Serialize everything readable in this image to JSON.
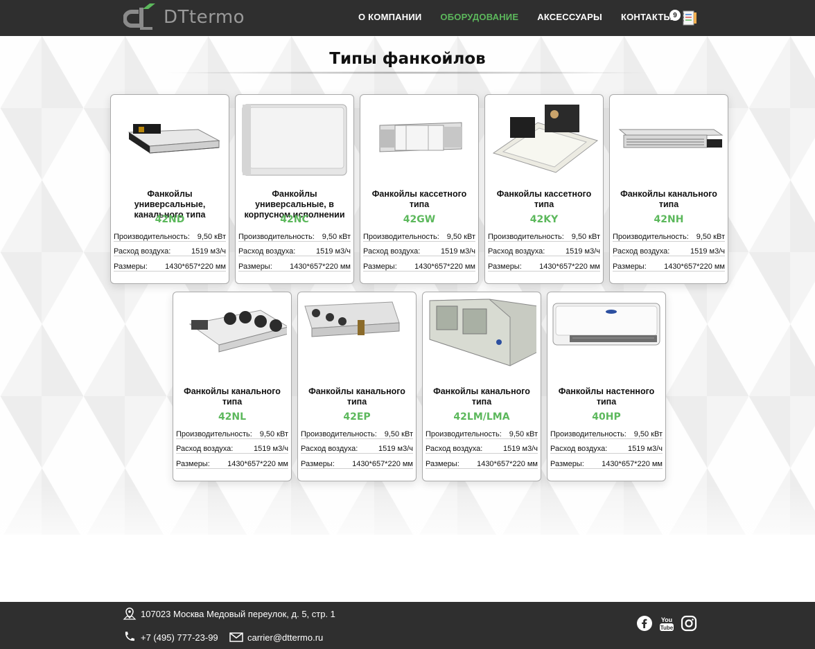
{
  "header": {
    "logo_text": "DTtermo",
    "nav": [
      {
        "label": "О КОМПАНИИ",
        "active": false
      },
      {
        "label": "ОБОРУДОВАНИЕ",
        "active": true
      },
      {
        "label": "АКСЕССУАРЫ",
        "active": false
      },
      {
        "label": "КОНТАКТЫ",
        "active": false
      }
    ],
    "cart_count": "9",
    "cart_icon": "notepad-cart-icon"
  },
  "page": {
    "title": "Типы фанкойлов"
  },
  "spec_labels": {
    "capacity": "Производительность:",
    "airflow": "Расход воздуха:",
    "size": "Размеры:"
  },
  "cards": [
    {
      "title": "Фанкойлы универсальные, канального типа",
      "model": "42ND",
      "capacity": "9,50 кВт",
      "airflow": "1519 м3/ч",
      "size": "1430*657*220 мм"
    },
    {
      "title": "Фанкойлы универсальные, в корпусном исполнении",
      "model": "42NC",
      "capacity": "9,50 кВт",
      "airflow": "1519 м3/ч",
      "size": "1430*657*220 мм"
    },
    {
      "title": "Фанкойлы кассетного типа",
      "model": "42GW",
      "capacity": "9,50 кВт",
      "airflow": "1519 м3/ч",
      "size": "1430*657*220 мм"
    },
    {
      "title": "Фанкойлы кассетного типа",
      "model": "42KY",
      "capacity": "9,50 кВт",
      "airflow": "1519 м3/ч",
      "size": "1430*657*220 мм"
    },
    {
      "title": "Фанкойлы канального типа",
      "model": "42NH",
      "capacity": "9,50 кВт",
      "airflow": "1519 м3/ч",
      "size": "1430*657*220 мм"
    },
    {
      "title": "Фанкойлы канального типа",
      "model": "42NL",
      "capacity": "9,50 кВт",
      "airflow": "1519 м3/ч",
      "size": "1430*657*220 мм"
    },
    {
      "title": "Фанкойлы канального типа",
      "model": "42EP",
      "capacity": "9,50 кВт",
      "airflow": "1519 м3/ч",
      "size": "1430*657*220 мм"
    },
    {
      "title": "Фанкойлы канального типа",
      "model": "42LM/LMA",
      "capacity": "9,50 кВт",
      "airflow": "1519 м3/ч",
      "size": "1430*657*220 мм"
    },
    {
      "title": "Фанкойлы настенного типа",
      "model": "40HP",
      "capacity": "9,50 кВт",
      "airflow": "1519 м3/ч",
      "size": "1430*657*220 мм"
    }
  ],
  "footer": {
    "address": "107023 Москва Медовый переулок, д. 5, стр. 1",
    "phone": "+7 (495) 777-23-99",
    "email": "carrier@dttermo.ru",
    "icons": [
      "map-pin-icon",
      "phone-icon",
      "mail-icon",
      "facebook-icon",
      "youtube-icon",
      "instagram-icon"
    ]
  },
  "colors": {
    "header_bg": "#2f2f2f",
    "accent": "#5cb85c"
  }
}
